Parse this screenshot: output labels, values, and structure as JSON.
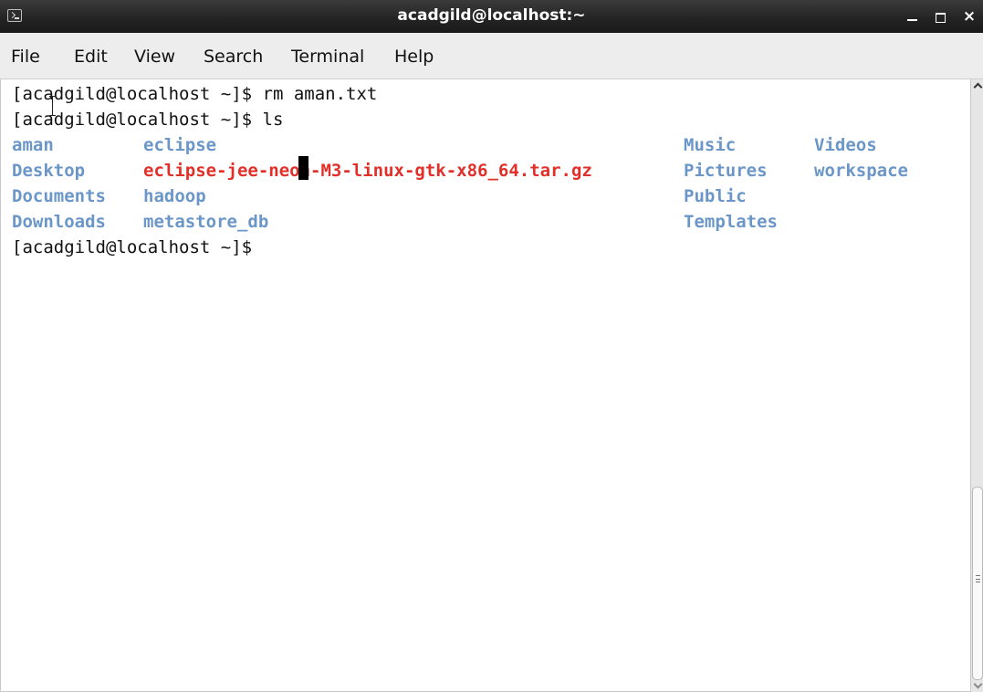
{
  "window": {
    "title": "acadgild@localhost:~",
    "icon": "terminal-icon",
    "controls": {
      "minimize": "minimize-icon",
      "maximize": "maximize-icon",
      "close": "×"
    }
  },
  "menu": [
    "File",
    "Edit",
    "View",
    "Search",
    "Terminal",
    "Help"
  ],
  "terminal": {
    "lines": [
      "[acadgild@localhost ~]$ rm aman.txt",
      "[acadgild@localhost ~]$ ls"
    ],
    "ls_output": {
      "col1": [
        "aman",
        "Desktop",
        "Documents",
        "Downloads"
      ],
      "col2": [
        "eclipse",
        "eclipse-jee-neon-M3-linux-gtk-x86_64.tar.gz",
        "hadoop",
        "metastore_db"
      ],
      "col3": [
        "Music",
        "Pictures",
        "Public",
        "Templates"
      ],
      "col4": [
        "Videos",
        "workspace"
      ]
    },
    "prompt": "[acadgild@localhost ~]$ "
  },
  "colors": {
    "directory": "#6b96c8",
    "archive": "#e1302a",
    "text": "#111111",
    "titlebar": "#242424"
  }
}
